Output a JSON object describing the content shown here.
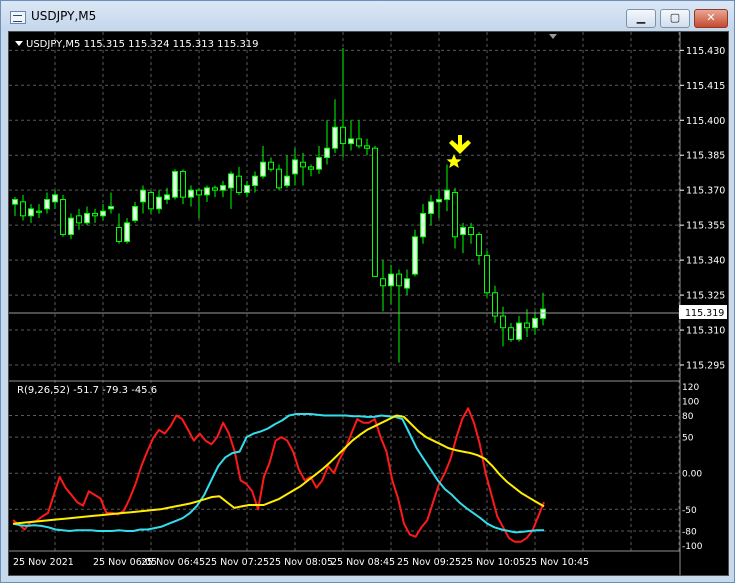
{
  "window": {
    "title": "USDJPY,M5",
    "minimize_label": "▁",
    "maximize_label": "▢",
    "close_label": "✕"
  },
  "chart_info": {
    "symbol_line": "USDJPY,M5  115.315 115.324 115.313 115.319",
    "current_price_label": "115.319"
  },
  "indicator": {
    "label": "R(9,26,52) -51.7 -79.3 -45.6"
  },
  "price_axis_labels": [
    "115.430",
    "115.415",
    "115.400",
    "115.385",
    "115.370",
    "115.355",
    "115.340",
    "115.325",
    "115.310",
    "115.295"
  ],
  "indicator_axis_labels": [
    "120",
    "100",
    "80",
    "50",
    "0.00",
    "-50",
    "-80",
    "-100"
  ],
  "time_axis_labels": [
    "25 Nov 2021",
    "25 Nov 06:05",
    "25 Nov 06:45",
    "25 Nov 07:25",
    "25 Nov 08:05",
    "25 Nov 08:45",
    "25 Nov 09:25",
    "25 Nov 10:05",
    "25 Nov 10:45"
  ],
  "colors": {
    "background": "#000000",
    "grid": "#5a5a5a",
    "bull_candle": "#e8ffe8",
    "bear_candle": "#000000",
    "wick": "#00ff00",
    "red_line": "#ff1a1a",
    "cyan_line": "#33ddee",
    "yellow_line": "#ffee00",
    "marker": "#ffff00"
  },
  "chart_data": {
    "type": "candlestick",
    "symbol": "USDJPY",
    "timeframe": "M5",
    "y_range": [
      115.289,
      115.437
    ],
    "candles": [
      {
        "o": 115.364,
        "h": 115.367,
        "l": 115.359,
        "c": 115.366
      },
      {
        "o": 115.365,
        "h": 115.368,
        "l": 115.357,
        "c": 115.359
      },
      {
        "o": 115.359,
        "h": 115.364,
        "l": 115.356,
        "c": 115.362
      },
      {
        "o": 115.361,
        "h": 115.364,
        "l": 115.358,
        "c": 115.3605
      },
      {
        "o": 115.362,
        "h": 115.369,
        "l": 115.36,
        "c": 115.366
      },
      {
        "o": 115.365,
        "h": 115.37,
        "l": 115.362,
        "c": 115.368
      },
      {
        "o": 115.366,
        "h": 115.368,
        "l": 115.35,
        "c": 115.351
      },
      {
        "o": 115.351,
        "h": 115.36,
        "l": 115.349,
        "c": 115.358
      },
      {
        "o": 115.359,
        "h": 115.362,
        "l": 115.353,
        "c": 115.356
      },
      {
        "o": 115.356,
        "h": 115.363,
        "l": 115.355,
        "c": 115.36
      },
      {
        "o": 115.36,
        "h": 115.362,
        "l": 115.356,
        "c": 115.359
      },
      {
        "o": 115.359,
        "h": 115.364,
        "l": 115.357,
        "c": 115.361
      },
      {
        "o": 115.362,
        "h": 115.369,
        "l": 115.36,
        "c": 115.363
      },
      {
        "o": 115.354,
        "h": 115.36,
        "l": 115.347,
        "c": 115.348
      },
      {
        "o": 115.348,
        "h": 115.358,
        "l": 115.347,
        "c": 115.356
      },
      {
        "o": 115.357,
        "h": 115.365,
        "l": 115.356,
        "c": 115.363
      },
      {
        "o": 115.365,
        "h": 115.372,
        "l": 115.36,
        "c": 115.37
      },
      {
        "o": 115.369,
        "h": 115.37,
        "l": 115.36,
        "c": 115.362
      },
      {
        "o": 115.362,
        "h": 115.37,
        "l": 115.36,
        "c": 115.367
      },
      {
        "o": 115.366,
        "h": 115.371,
        "l": 115.364,
        "c": 115.368
      },
      {
        "o": 115.367,
        "h": 115.379,
        "l": 115.366,
        "c": 115.378
      },
      {
        "o": 115.378,
        "h": 115.379,
        "l": 115.364,
        "c": 115.367
      },
      {
        "o": 115.367,
        "h": 115.372,
        "l": 115.363,
        "c": 115.37
      },
      {
        "o": 115.37,
        "h": 115.371,
        "l": 115.358,
        "c": 115.368
      },
      {
        "o": 115.368,
        "h": 115.372,
        "l": 115.365,
        "c": 115.371
      },
      {
        "o": 115.371,
        "h": 115.372,
        "l": 115.367,
        "c": 115.37
      },
      {
        "o": 115.37,
        "h": 115.374,
        "l": 115.367,
        "c": 115.372
      },
      {
        "o": 115.371,
        "h": 115.378,
        "l": 115.362,
        "c": 115.377
      },
      {
        "o": 115.376,
        "h": 115.38,
        "l": 115.368,
        "c": 115.369
      },
      {
        "o": 115.369,
        "h": 115.374,
        "l": 115.367,
        "c": 115.372
      },
      {
        "o": 115.372,
        "h": 115.378,
        "l": 115.369,
        "c": 115.376
      },
      {
        "o": 115.376,
        "h": 115.389,
        "l": 115.375,
        "c": 115.382
      },
      {
        "o": 115.382,
        "h": 115.384,
        "l": 115.378,
        "c": 115.379
      },
      {
        "o": 115.379,
        "h": 115.381,
        "l": 115.37,
        "c": 115.371
      },
      {
        "o": 115.372,
        "h": 115.385,
        "l": 115.371,
        "c": 115.376
      },
      {
        "o": 115.377,
        "h": 115.388,
        "l": 115.372,
        "c": 115.383
      },
      {
        "o": 115.382,
        "h": 115.386,
        "l": 115.372,
        "c": 115.38
      },
      {
        "o": 115.38,
        "h": 115.381,
        "l": 115.376,
        "c": 115.379
      },
      {
        "o": 115.379,
        "h": 115.389,
        "l": 115.377,
        "c": 115.384
      },
      {
        "o": 115.384,
        "h": 115.4,
        "l": 115.381,
        "c": 115.388
      },
      {
        "o": 115.388,
        "h": 115.409,
        "l": 115.386,
        "c": 115.397
      },
      {
        "o": 115.397,
        "h": 115.431,
        "l": 115.384,
        "c": 115.39
      },
      {
        "o": 115.39,
        "h": 115.4,
        "l": 115.387,
        "c": 115.392
      },
      {
        "o": 115.392,
        "h": 115.4,
        "l": 115.388,
        "c": 115.389
      },
      {
        "o": 115.389,
        "h": 115.392,
        "l": 115.385,
        "c": 115.388
      },
      {
        "o": 115.388,
        "h": 115.389,
        "l": 115.337,
        "c": 115.333
      },
      {
        "o": 115.332,
        "h": 115.34,
        "l": 115.318,
        "c": 115.329
      },
      {
        "o": 115.329,
        "h": 115.338,
        "l": 115.321,
        "c": 115.334
      },
      {
        "o": 115.334,
        "h": 115.336,
        "l": 115.296,
        "c": 115.329
      },
      {
        "o": 115.328,
        "h": 115.336,
        "l": 115.325,
        "c": 115.332
      },
      {
        "o": 115.334,
        "h": 115.353,
        "l": 115.333,
        "c": 115.35
      },
      {
        "o": 115.35,
        "h": 115.364,
        "l": 115.347,
        "c": 115.36
      },
      {
        "o": 115.36,
        "h": 115.368,
        "l": 115.355,
        "c": 115.365
      },
      {
        "o": 115.365,
        "h": 115.37,
        "l": 115.358,
        "c": 115.366
      },
      {
        "o": 115.366,
        "h": 115.381,
        "l": 115.361,
        "c": 115.37
      },
      {
        "o": 115.369,
        "h": 115.371,
        "l": 115.345,
        "c": 115.35
      },
      {
        "o": 115.351,
        "h": 115.356,
        "l": 115.343,
        "c": 115.354
      },
      {
        "o": 115.354,
        "h": 115.356,
        "l": 115.347,
        "c": 115.351
      },
      {
        "o": 115.351,
        "h": 115.352,
        "l": 115.338,
        "c": 115.342
      },
      {
        "o": 115.342,
        "h": 115.344,
        "l": 115.324,
        "c": 115.326
      },
      {
        "o": 115.326,
        "h": 115.329,
        "l": 115.313,
        "c": 115.316
      },
      {
        "o": 115.316,
        "h": 115.32,
        "l": 115.303,
        "c": 115.311
      },
      {
        "o": 115.311,
        "h": 115.313,
        "l": 115.305,
        "c": 115.306
      },
      {
        "o": 115.306,
        "h": 115.316,
        "l": 115.305,
        "c": 115.313
      },
      {
        "o": 115.313,
        "h": 115.319,
        "l": 115.307,
        "c": 115.311
      },
      {
        "o": 115.311,
        "h": 115.318,
        "l": 115.308,
        "c": 115.315
      },
      {
        "o": 115.315,
        "h": 115.326,
        "l": 115.312,
        "c": 115.319
      }
    ],
    "current_price": 115.319,
    "marker_candle_index": 55,
    "indicator": {
      "name": "R(9,26,52)",
      "y_range": [
        -105,
        125
      ],
      "series": [
        {
          "name": "R(9)",
          "color": "#ff1a1a",
          "values": [
            -65,
            -71,
            -78,
            -68,
            -66,
            -60,
            -55,
            -30,
            -5,
            -20,
            -30,
            -40,
            -45,
            -25,
            -30,
            -35,
            -55,
            -55,
            -57,
            -52,
            -35,
            -15,
            10,
            30,
            48,
            60,
            55,
            65,
            80,
            75,
            60,
            45,
            55,
            45,
            40,
            50,
            70,
            55,
            30,
            -10,
            -15,
            -25,
            -50,
            -5,
            15,
            45,
            50,
            45,
            30,
            5,
            -10,
            -5,
            -20,
            -10,
            10,
            0,
            20,
            35,
            55,
            75,
            70,
            70,
            75,
            50,
            30,
            -10,
            -35,
            -70,
            -85,
            -88,
            -75,
            -65,
            -40,
            -15,
            0,
            20,
            50,
            75,
            90,
            70,
            40,
            0,
            -30,
            -60,
            -75,
            -90,
            -95,
            -95,
            -90,
            -80,
            -60,
            -40
          ]
        },
        {
          "name": "R(26)",
          "color": "#33ddee",
          "values": [
            -70,
            -72,
            -73,
            -72,
            -73,
            -75,
            -78,
            -79,
            -80,
            -79,
            -79,
            -79,
            -80,
            -80,
            -80,
            -79,
            -80,
            -80,
            -78,
            -78,
            -76,
            -74,
            -70,
            -66,
            -62,
            -55,
            -45,
            -30,
            -10,
            10,
            22,
            28,
            30,
            50,
            55,
            58,
            62,
            68,
            73,
            80,
            82,
            82,
            82,
            81,
            80,
            80,
            80,
            80,
            79,
            79,
            78,
            78,
            80,
            79,
            78,
            75,
            55,
            35,
            20,
            5,
            -10,
            -22,
            -30,
            -40,
            -48,
            -55,
            -62,
            -70,
            -75,
            -78,
            -80,
            -82,
            -81,
            -80,
            -79,
            -79
          ]
        },
        {
          "name": "R(52)",
          "color": "#ffee00",
          "values": [
            -70,
            -69,
            -68,
            -67,
            -66,
            -65,
            -64,
            -63,
            -62,
            -61,
            -60,
            -59,
            -58,
            -57,
            -56,
            -55,
            -54,
            -53,
            -52,
            -51,
            -50,
            -48,
            -46,
            -44,
            -42,
            -39,
            -36,
            -33,
            -32,
            -40,
            -48,
            -46,
            -44,
            -44,
            -44,
            -40,
            -36,
            -30,
            -24,
            -18,
            -10,
            -2,
            6,
            15,
            25,
            35,
            45,
            53,
            60,
            65,
            70,
            75,
            80,
            78,
            68,
            58,
            50,
            45,
            40,
            35,
            32,
            30,
            28,
            25,
            20,
            10,
            -2,
            -12,
            -20,
            -28,
            -34,
            -40,
            -46
          ]
        }
      ]
    },
    "title": "USDJPY,M5"
  }
}
